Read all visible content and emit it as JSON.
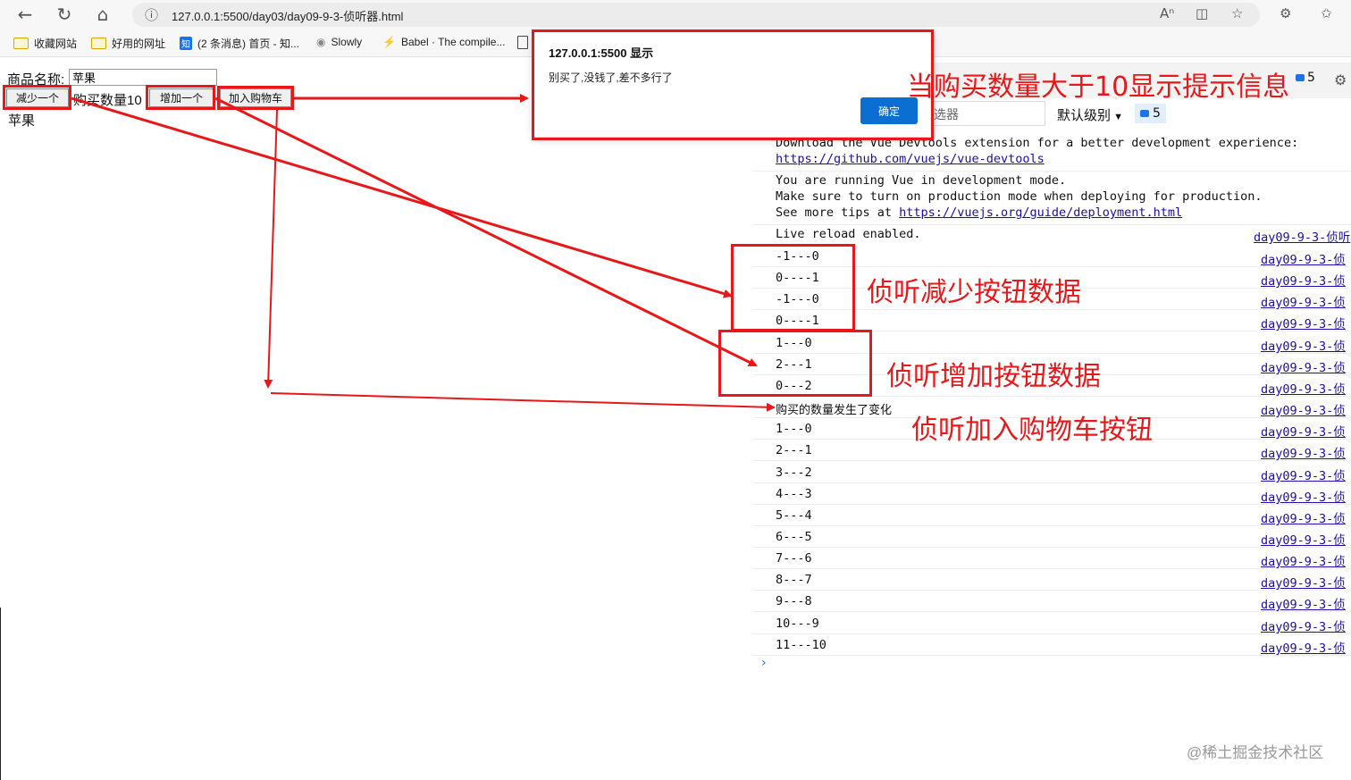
{
  "browser": {
    "url": "127.0.0.1:5500/day03/day09-9-3-侦听器.html",
    "bookmarks": [
      "收藏网站",
      "好用的网址",
      "(2 条消息) 首页 - 知...",
      "Slowly",
      "Babel · The compile..."
    ],
    "zhihu_icon_text": "知"
  },
  "page": {
    "name_label": "商品名称:",
    "name_value": "苹果",
    "decrease_button": "减少一个",
    "quantity_label": "购买数量10",
    "increase_button": "增加一个",
    "add_cart_button": "加入购物车",
    "product_text": "苹果"
  },
  "dialog": {
    "title": "127.0.0.1:5500 显示",
    "message": "别买了,没钱了,差不多行了",
    "ok_button": "确定"
  },
  "devtools": {
    "filter_placeholder": "选器",
    "level_label": "默认级别",
    "message_count": "5",
    "message_count_top": "5",
    "console": {
      "devtools_line1": "Download the Vue Devtools extension for a better development experience:",
      "devtools_link": "https://github.com/vuejs/vue-devtools",
      "dev_line1": "You are running Vue in development mode.",
      "dev_line2": "Make sure to turn on production mode when deploying for production.",
      "dev_line3_prefix": "See more tips at ",
      "dev_link": "https://vuejs.org/guide/deployment.html",
      "live_reload": "Live reload enabled.",
      "live_reload_source": "day09-9-3-侦听",
      "log_rows": [
        {
          "text": "-1---0",
          "source": "day09-9-3-侦"
        },
        {
          "text": "0----1",
          "source": "day09-9-3-侦"
        },
        {
          "text": "-1---0",
          "source": "day09-9-3-侦"
        },
        {
          "text": "0----1",
          "source": "day09-9-3-侦"
        },
        {
          "text": "1---0",
          "source": "day09-9-3-侦"
        },
        {
          "text": "2---1",
          "source": "day09-9-3-侦"
        },
        {
          "text": "0---2",
          "source": "day09-9-3-侦"
        },
        {
          "text": "购买的数量发生了变化",
          "source": "day09-9-3-侦"
        },
        {
          "text": "1---0",
          "source": "day09-9-3-侦"
        },
        {
          "text": "2---1",
          "source": "day09-9-3-侦"
        },
        {
          "text": "3---2",
          "source": "day09-9-3-侦"
        },
        {
          "text": "4---3",
          "source": "day09-9-3-侦"
        },
        {
          "text": "5---4",
          "source": "day09-9-3-侦"
        },
        {
          "text": "6---5",
          "source": "day09-9-3-侦"
        },
        {
          "text": "7---6",
          "source": "day09-9-3-侦"
        },
        {
          "text": "8---7",
          "source": "day09-9-3-侦"
        },
        {
          "text": "9---8",
          "source": "day09-9-3-侦"
        },
        {
          "text": "10---9",
          "source": "day09-9-3-侦"
        },
        {
          "text": "11---10",
          "source": "day09-9-3-侦"
        }
      ],
      "prompt": "›"
    }
  },
  "annotations": {
    "alert_note": "当购买数量大于10显示提示信息",
    "decrease_note": "侦听减少按钮数据",
    "increase_note": "侦听增加按钮数据",
    "cart_note": "侦听加入购物车按钮",
    "color": "#e8171a"
  },
  "watermark": "@稀土掘金技术社区"
}
